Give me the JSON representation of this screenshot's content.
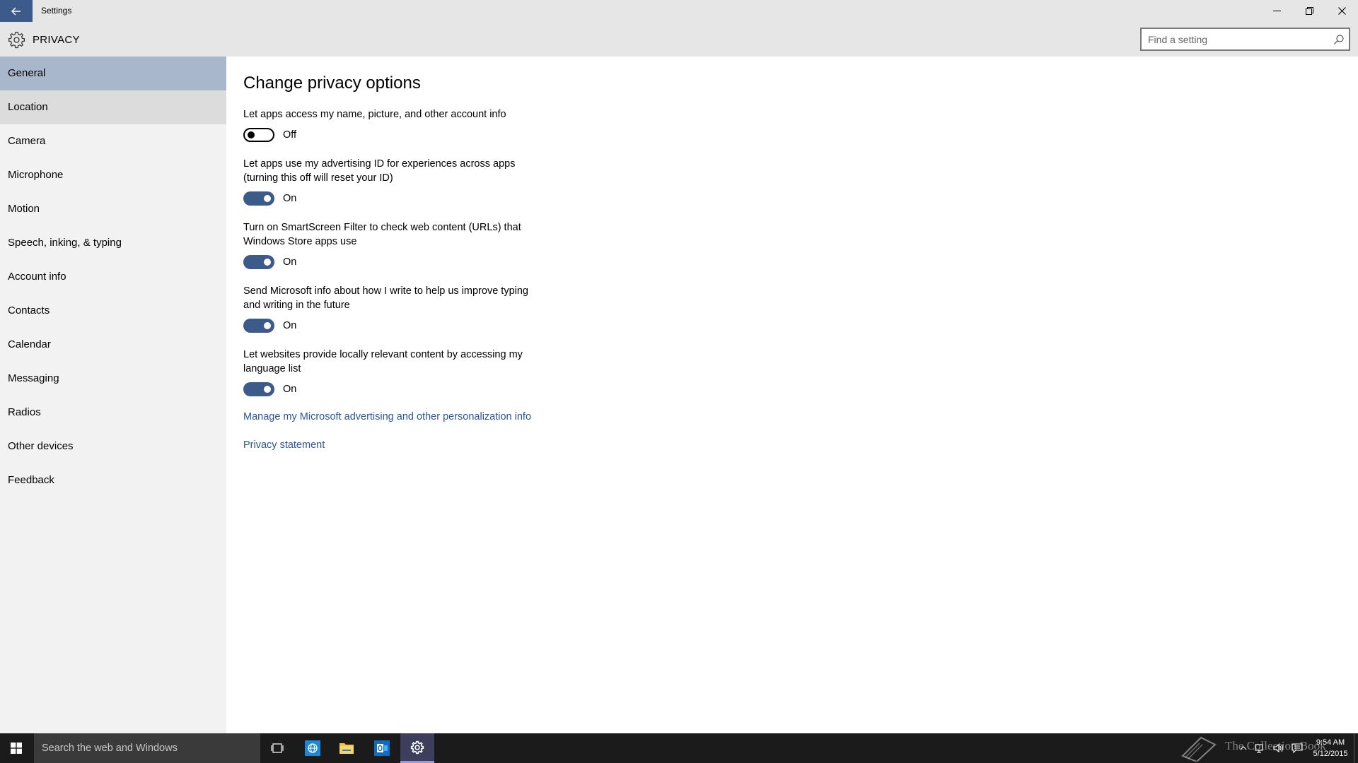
{
  "window": {
    "title": "Settings",
    "controls": [
      "minimize",
      "restore",
      "close"
    ]
  },
  "header": {
    "title": "PRIVACY",
    "search_placeholder": "Find a setting"
  },
  "sidebar": {
    "items": [
      {
        "label": "General",
        "state": "selected"
      },
      {
        "label": "Location",
        "state": "hover"
      },
      {
        "label": "Camera",
        "state": "normal"
      },
      {
        "label": "Microphone",
        "state": "normal"
      },
      {
        "label": "Motion",
        "state": "normal"
      },
      {
        "label": "Speech, inking, & typing",
        "state": "normal"
      },
      {
        "label": "Account info",
        "state": "normal"
      },
      {
        "label": "Contacts",
        "state": "normal"
      },
      {
        "label": "Calendar",
        "state": "normal"
      },
      {
        "label": "Messaging",
        "state": "normal"
      },
      {
        "label": "Radios",
        "state": "normal"
      },
      {
        "label": "Other devices",
        "state": "normal"
      },
      {
        "label": "Feedback",
        "state": "normal"
      }
    ]
  },
  "main": {
    "section_title": "Change privacy options",
    "settings": [
      {
        "desc_line1": "Let apps access my name, picture, and other account info",
        "desc_line2": "",
        "state": "Off",
        "on": false
      },
      {
        "desc_line1": "Let apps use my advertising ID for experiences across apps",
        "desc_line2": "(turning this off will reset your ID)",
        "state": "On",
        "on": true
      },
      {
        "desc_line1": "Turn on SmartScreen Filter to check web content (URLs) that",
        "desc_line2": "Windows Store apps use",
        "state": "On",
        "on": true
      },
      {
        "desc_line1": "Send Microsoft info about how I write to help us improve typing",
        "desc_line2": "and writing in the future",
        "state": "On",
        "on": true
      },
      {
        "desc_line1": "Let websites provide locally relevant content by accessing my",
        "desc_line2": "language list",
        "state": "On",
        "on": true
      }
    ],
    "links": [
      {
        "label": "Manage my Microsoft advertising and other personalization info"
      },
      {
        "label": "Privacy statement"
      }
    ]
  },
  "taskbar": {
    "search_text": "Search the web and Windows",
    "pinned": [
      "task-view-icon",
      "internet-explorer-icon",
      "file-explorer-icon",
      "outlook-icon",
      "settings-icon"
    ],
    "active_app": "settings-icon",
    "watermark": "The Collection Book",
    "clock_time": "9:54 AM",
    "clock_date": "5/12/2015"
  },
  "colors": {
    "accent": "#3c5a8a",
    "selected_nav": "#a9b7cc",
    "link": "#2a5699",
    "taskbar": "#1b1b1b"
  }
}
